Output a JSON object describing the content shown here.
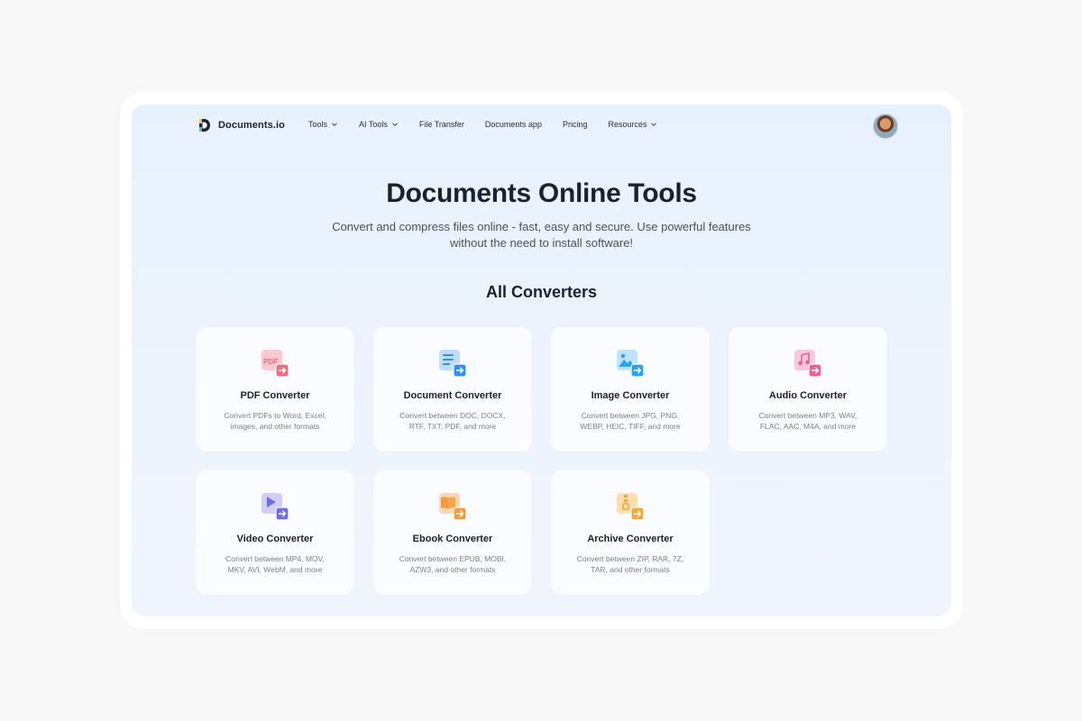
{
  "brand": {
    "name": "Documents.io"
  },
  "nav": {
    "items": [
      {
        "label": "Tools",
        "dropdown": true
      },
      {
        "label": "AI Tools",
        "dropdown": true
      },
      {
        "label": "File Transfer",
        "dropdown": false
      },
      {
        "label": "Documents app",
        "dropdown": false
      },
      {
        "label": "Pricing",
        "dropdown": false
      },
      {
        "label": "Resources",
        "dropdown": true
      }
    ]
  },
  "hero": {
    "title": "Documents Online Tools",
    "subtitle": "Convert and compress files online - fast, easy and secure. Use powerful features without the need to install software!"
  },
  "section": {
    "title": "All Converters"
  },
  "converters": [
    {
      "title": "PDF Converter",
      "desc": "Convert PDFs to Word, Excel, images, and other formats",
      "icon": "pdf-icon",
      "color": "#f26a7e",
      "bg": "#fcc9d1"
    },
    {
      "title": "Document Converter",
      "desc": "Convert between DOC, DOCX, RTF, TXT, PDF, and more",
      "icon": "document-icon",
      "color": "#2f8ff0",
      "bg": "#bfdcfb"
    },
    {
      "title": "Image Converter",
      "desc": "Convert between JPG, PNG, WEBP, HEIC, TIFF, and more",
      "icon": "image-icon",
      "color": "#2aa3ef",
      "bg": "#bfe3fb"
    },
    {
      "title": "Audio Converter",
      "desc": "Convert between MP3, WAV, FLAC, AAC, M4A, and more",
      "icon": "music-icon",
      "color": "#ec5f9a",
      "bg": "#fbc7dc"
    },
    {
      "title": "Video Converter",
      "desc": "Convert between MP4, MOV, MKV, AVI, WebM, and more",
      "icon": "video-icon",
      "color": "#6f6ee8",
      "bg": "#cfcffa"
    },
    {
      "title": "Ebook Converter",
      "desc": "Convert between EPUB, MOBI, AZW3, and other formats",
      "icon": "book-icon",
      "color": "#f39a3c",
      "bg": "#fcd7b0"
    },
    {
      "title": "Archive Converter",
      "desc": "Convert between ZIP, RAR, 7Z, TAR, and other formats",
      "icon": "archive-icon",
      "color": "#f0a93a",
      "bg": "#fbdfae"
    }
  ]
}
